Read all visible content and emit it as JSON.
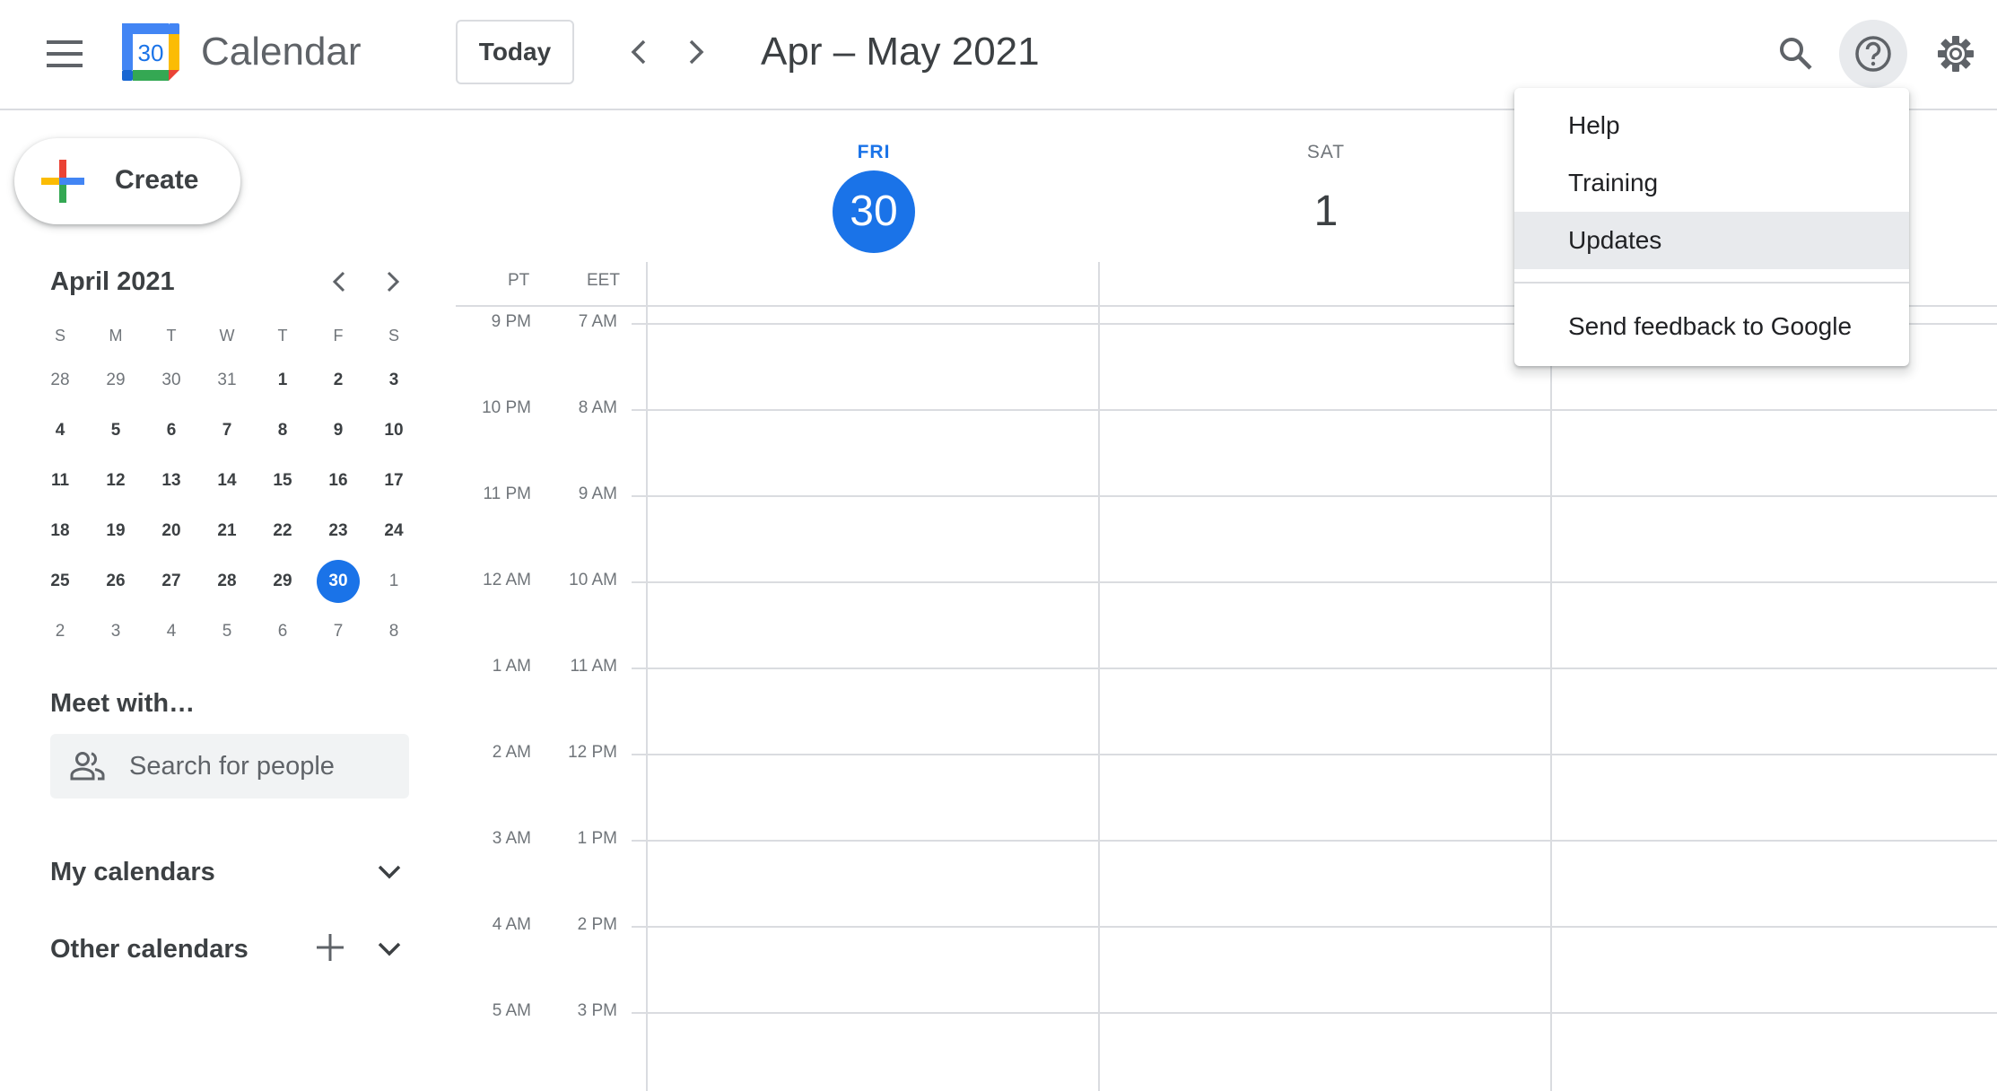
{
  "header": {
    "app_name": "Calendar",
    "logo_day": "30",
    "today_label": "Today",
    "date_range": "Apr – May 2021"
  },
  "sidebar": {
    "create_label": "Create",
    "mini_calendar": {
      "title": "April 2021",
      "weekdays": [
        "S",
        "M",
        "T",
        "W",
        "T",
        "F",
        "S"
      ],
      "weeks": [
        [
          "28",
          "29",
          "30",
          "31",
          "1",
          "2",
          "3"
        ],
        [
          "4",
          "5",
          "6",
          "7",
          "8",
          "9",
          "10"
        ],
        [
          "11",
          "12",
          "13",
          "14",
          "15",
          "16",
          "17"
        ],
        [
          "18",
          "19",
          "20",
          "21",
          "22",
          "23",
          "24"
        ],
        [
          "25",
          "26",
          "27",
          "28",
          "29",
          "30",
          "1"
        ],
        [
          "2",
          "3",
          "4",
          "5",
          "6",
          "7",
          "8"
        ]
      ],
      "selected": "30"
    },
    "meet_with": {
      "title": "Meet with…",
      "placeholder": "Search for people"
    },
    "my_calendars": "My calendars",
    "other_calendars": "Other calendars"
  },
  "calendar": {
    "days": [
      {
        "dow": "FRI",
        "num": "30",
        "active": true
      },
      {
        "dow": "SAT",
        "num": "1",
        "active": false
      }
    ],
    "timezones": [
      "PT",
      "EET"
    ],
    "times_pt": [
      "9 PM",
      "10 PM",
      "11 PM",
      "12 AM",
      "1 AM",
      "2 AM",
      "3 AM",
      "4 AM",
      "5 AM"
    ],
    "times_eet": [
      "7 AM",
      "8 AM",
      "9 AM",
      "10 AM",
      "11 AM",
      "12 PM",
      "1 PM",
      "2 PM",
      "3 PM"
    ]
  },
  "help_menu": {
    "items": [
      "Help",
      "Training",
      "Updates",
      "Send feedback to Google"
    ],
    "highlighted": "Updates"
  },
  "colors": {
    "accent": "#1a73e8",
    "border": "#dadce0",
    "text": "#3c4043",
    "muted": "#70757a"
  }
}
